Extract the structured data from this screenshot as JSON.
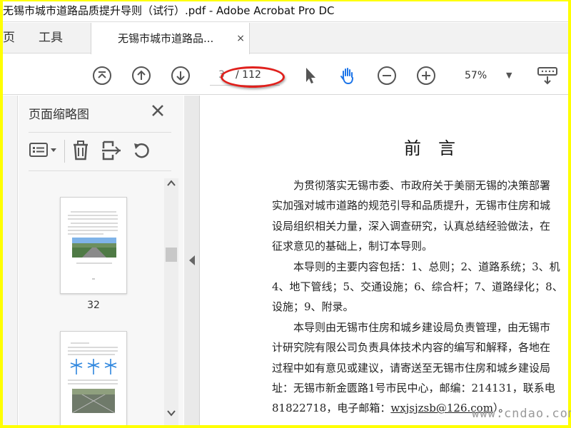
{
  "window": {
    "title": "无锡市城市道路品质提升导则（试行）.pdf - Adobe Acrobat Pro DC"
  },
  "tabs": {
    "home": "页",
    "tools": "工具",
    "doc": "无锡市城市道路品...",
    "close": "×"
  },
  "toolbar": {
    "current_page": "3",
    "total_pages": "/ 112",
    "zoom": "57%",
    "icons": [
      "fit-page-icon",
      "page-up-icon",
      "page-down-icon",
      "select-pointer-icon",
      "hand-tool-icon",
      "zoom-out-icon",
      "zoom-in-icon",
      "keyboard-scroll-icon"
    ]
  },
  "sidepanel": {
    "title": "页面缩略图",
    "thumb_labels": [
      "32"
    ]
  },
  "document": {
    "heading": "前言",
    "lines": [
      "　　为贯彻落实无锡市委、市政府关于美丽无锡的决策部署",
      "实加强对城市道路的规范引导和品质提升，无锡市住房和城",
      "设局组织相关力量，深入调查研究，认真总结经验做法，在",
      "征求意见的基础上，制订本导则。",
      "　　本导则的主要内容包括：1、总则；2、道路系统；3、机",
      "4、地下管线；5、交通设施；6、综合杆；7、道路绿化；8、",
      "设施；9、附录。",
      "　　本导则由无锡市住房和城乡建设局负责管理，由无锡市",
      "计研究院有限公司负责具体技术内容的编写和解释，各地在",
      "过程中如有意见或建议，请寄送至无锡市住房和城乡建设局",
      "址：无锡市新金匮路1号市民中心，邮编：214131，联系电"
    ],
    "last_line_prefix": "81822718，电子邮箱：",
    "email": "wxjsjzsb@126.com",
    "last_line_suffix": "）。"
  },
  "watermark": "www.cndao.com",
  "colors": {
    "accent_blue": "#1a73e8",
    "annotation_red": "#e0201c",
    "frame_yellow": "#ffff00"
  }
}
